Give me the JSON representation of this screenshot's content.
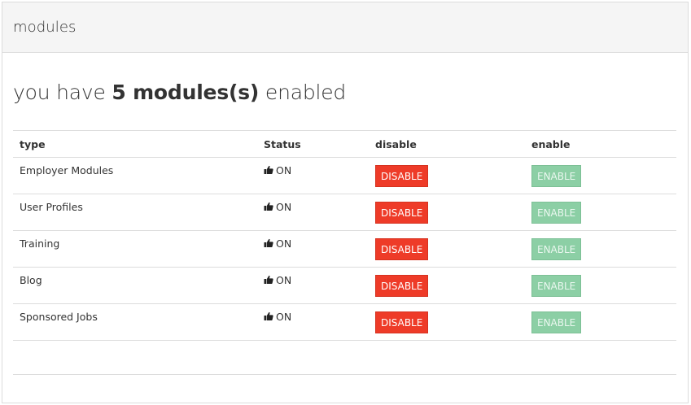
{
  "panel": {
    "title": "modules"
  },
  "summary": {
    "prefix": "you have ",
    "count_text": "5 modules(s)",
    "suffix": " enabled"
  },
  "table": {
    "headers": {
      "type": "type",
      "status": "Status",
      "disable": "disable",
      "enable": "enable"
    },
    "rows": [
      {
        "type": "Employer Modules",
        "status_icon": "thumbs-up-icon",
        "status": "ON",
        "disable": "DISABLE",
        "enable": "ENABLE"
      },
      {
        "type": "User Profiles",
        "status_icon": "thumbs-up-icon",
        "status": "ON",
        "disable": "DISABLE",
        "enable": "ENABLE"
      },
      {
        "type": "Training",
        "status_icon": "thumbs-up-icon",
        "status": "ON",
        "disable": "DISABLE",
        "enable": "ENABLE"
      },
      {
        "type": "Blog",
        "status_icon": "thumbs-up-icon",
        "status": "ON",
        "disable": "DISABLE",
        "enable": "ENABLE"
      },
      {
        "type": "Sponsored Jobs",
        "status_icon": "thumbs-up-icon",
        "status": "ON",
        "disable": "DISABLE",
        "enable": "ENABLE"
      }
    ]
  },
  "colors": {
    "disable_button": "#ee3b28",
    "enable_button": "#8ccfa5",
    "header_background": "#f5f5f5"
  }
}
